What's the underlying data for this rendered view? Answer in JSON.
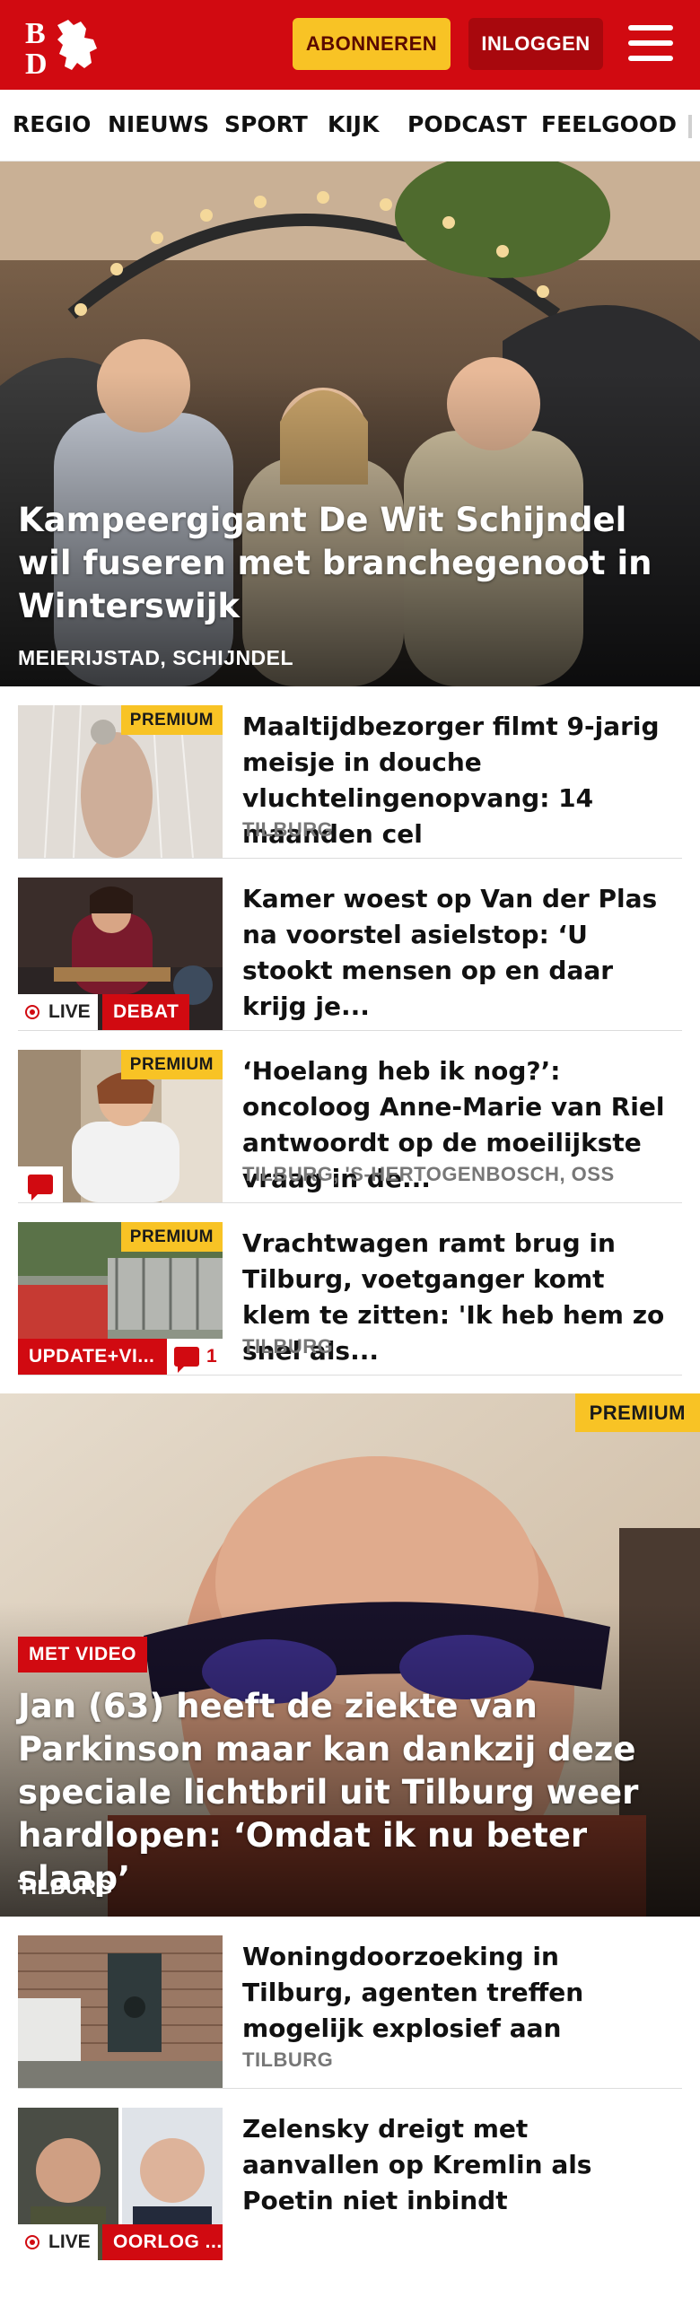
{
  "header": {
    "logo_text": "BD",
    "subscribe_label": "ABONNEREN",
    "login_label": "INLOGGEN",
    "brand_color": "#d10a11",
    "accent_color": "#f8c325"
  },
  "nav": {
    "items": [
      "REGIO",
      "NIEUWS",
      "SPORT",
      "KIJK",
      "PODCAST",
      "FEELGOOD"
    ]
  },
  "hero1": {
    "title": "Kampeergigant De Wit Schijndel wil fuseren met branchegenoot in Winterswijk",
    "location": "MEIERIJSTAD, SCHIJNDEL"
  },
  "articles": [
    {
      "title": "Maaltijdbezorger filmt 9-jarig meisje in douche vluchtelingen­opvang: 14 maanden cel",
      "location": "TILBURG",
      "premium": "PREMIUM"
    },
    {
      "title": "Kamer woest op Van der Plas na voorstel asielstop: ‘U stookt mensen op en daar krijg je...",
      "live": "LIVE",
      "tag": "DEBAT"
    },
    {
      "title": "‘Hoelang heb ik nog?’: oncoloog Anne-Marie van Riel antwoordt op de moeilijkste vraag in de...",
      "location": "TILBURG, 'S-HERTOGENBOSCH, OSS",
      "premium": "PREMIUM"
    },
    {
      "title": "Vrachtwagen ramt brug in Tilburg, voetganger komt klem te zitten: 'Ik heb hem zo snel als...",
      "location": "TILBURG",
      "premium": "PREMIUM",
      "tag": "UPDATE+VI...",
      "comments": "1"
    }
  ],
  "hero2": {
    "premium": "PREMIUM",
    "video_badge": "MET VIDEO",
    "title": "Jan (63) heeft de ziekte van Parkinson maar kan dankzij deze speciale lichtbril uit Tilburg weer hardlopen: ‘Omdat ik nu beter slaap’",
    "location": "TILBURG"
  },
  "articles2": [
    {
      "title": "Woningdoorzoeking in Tilburg, agenten treffen mogelijk explosief aan",
      "location": "TILBURG"
    },
    {
      "title": "Zelensky dreigt met aanvallen op Kremlin als Poetin niet inbindt",
      "live": "LIVE",
      "tag": "OORLOG ..."
    }
  ]
}
